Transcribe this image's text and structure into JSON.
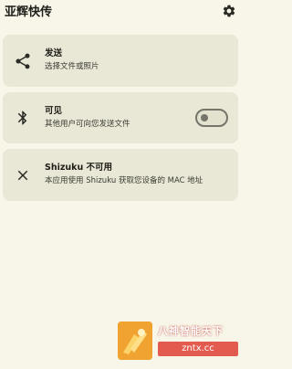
{
  "app": {
    "title": "亚辉快传"
  },
  "icons": {
    "settings": "gear-icon",
    "send": "share-icon",
    "visible": "bluetooth-icon",
    "shizuku": "close-icon"
  },
  "cards": {
    "send": {
      "title": "发送",
      "subtitle": "选择文件或照片"
    },
    "visible": {
      "title": "可见",
      "subtitle": "其他用户可向您发送文件",
      "toggle_on": false
    },
    "shizuku": {
      "title": "Shizuku 不可用",
      "subtitle": "本应用使用 Shizuku 获取您设备的 MAC 地址"
    }
  },
  "watermark": {
    "title": "八神智能天下",
    "site": "zntx.cc"
  },
  "colors": {
    "background": "#f7f6e9",
    "card": "#e9e8d6",
    "text": "#1d1c16",
    "toggle_outline": "#75756a"
  }
}
